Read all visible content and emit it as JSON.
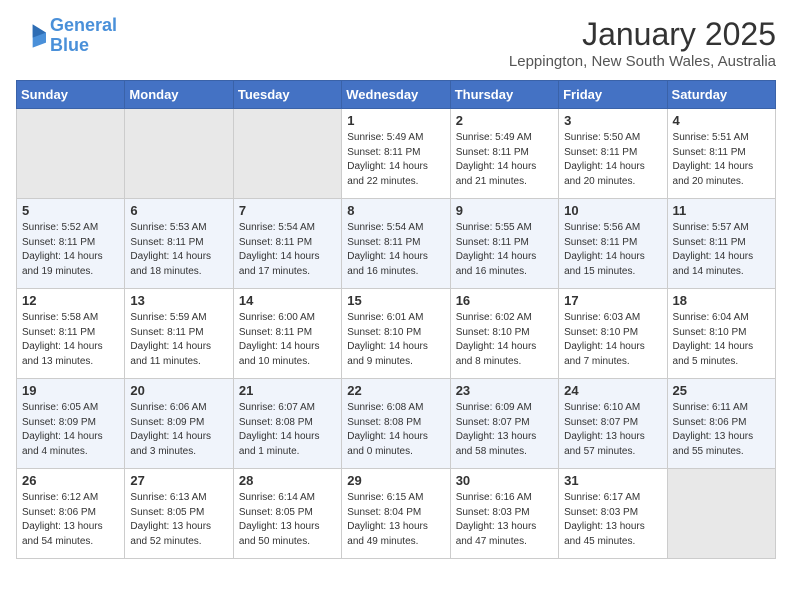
{
  "logo": {
    "line1": "General",
    "line2": "Blue"
  },
  "title": "January 2025",
  "location": "Leppington, New South Wales, Australia",
  "weekdays": [
    "Sunday",
    "Monday",
    "Tuesday",
    "Wednesday",
    "Thursday",
    "Friday",
    "Saturday"
  ],
  "weeks": [
    [
      {
        "day": "",
        "info": ""
      },
      {
        "day": "",
        "info": ""
      },
      {
        "day": "",
        "info": ""
      },
      {
        "day": "1",
        "info": "Sunrise: 5:49 AM\nSunset: 8:11 PM\nDaylight: 14 hours\nand 22 minutes."
      },
      {
        "day": "2",
        "info": "Sunrise: 5:49 AM\nSunset: 8:11 PM\nDaylight: 14 hours\nand 21 minutes."
      },
      {
        "day": "3",
        "info": "Sunrise: 5:50 AM\nSunset: 8:11 PM\nDaylight: 14 hours\nand 20 minutes."
      },
      {
        "day": "4",
        "info": "Sunrise: 5:51 AM\nSunset: 8:11 PM\nDaylight: 14 hours\nand 20 minutes."
      }
    ],
    [
      {
        "day": "5",
        "info": "Sunrise: 5:52 AM\nSunset: 8:11 PM\nDaylight: 14 hours\nand 19 minutes."
      },
      {
        "day": "6",
        "info": "Sunrise: 5:53 AM\nSunset: 8:11 PM\nDaylight: 14 hours\nand 18 minutes."
      },
      {
        "day": "7",
        "info": "Sunrise: 5:54 AM\nSunset: 8:11 PM\nDaylight: 14 hours\nand 17 minutes."
      },
      {
        "day": "8",
        "info": "Sunrise: 5:54 AM\nSunset: 8:11 PM\nDaylight: 14 hours\nand 16 minutes."
      },
      {
        "day": "9",
        "info": "Sunrise: 5:55 AM\nSunset: 8:11 PM\nDaylight: 14 hours\nand 16 minutes."
      },
      {
        "day": "10",
        "info": "Sunrise: 5:56 AM\nSunset: 8:11 PM\nDaylight: 14 hours\nand 15 minutes."
      },
      {
        "day": "11",
        "info": "Sunrise: 5:57 AM\nSunset: 8:11 PM\nDaylight: 14 hours\nand 14 minutes."
      }
    ],
    [
      {
        "day": "12",
        "info": "Sunrise: 5:58 AM\nSunset: 8:11 PM\nDaylight: 14 hours\nand 13 minutes."
      },
      {
        "day": "13",
        "info": "Sunrise: 5:59 AM\nSunset: 8:11 PM\nDaylight: 14 hours\nand 11 minutes."
      },
      {
        "day": "14",
        "info": "Sunrise: 6:00 AM\nSunset: 8:11 PM\nDaylight: 14 hours\nand 10 minutes."
      },
      {
        "day": "15",
        "info": "Sunrise: 6:01 AM\nSunset: 8:10 PM\nDaylight: 14 hours\nand 9 minutes."
      },
      {
        "day": "16",
        "info": "Sunrise: 6:02 AM\nSunset: 8:10 PM\nDaylight: 14 hours\nand 8 minutes."
      },
      {
        "day": "17",
        "info": "Sunrise: 6:03 AM\nSunset: 8:10 PM\nDaylight: 14 hours\nand 7 minutes."
      },
      {
        "day": "18",
        "info": "Sunrise: 6:04 AM\nSunset: 8:10 PM\nDaylight: 14 hours\nand 5 minutes."
      }
    ],
    [
      {
        "day": "19",
        "info": "Sunrise: 6:05 AM\nSunset: 8:09 PM\nDaylight: 14 hours\nand 4 minutes."
      },
      {
        "day": "20",
        "info": "Sunrise: 6:06 AM\nSunset: 8:09 PM\nDaylight: 14 hours\nand 3 minutes."
      },
      {
        "day": "21",
        "info": "Sunrise: 6:07 AM\nSunset: 8:08 PM\nDaylight: 14 hours\nand 1 minute."
      },
      {
        "day": "22",
        "info": "Sunrise: 6:08 AM\nSunset: 8:08 PM\nDaylight: 14 hours\nand 0 minutes."
      },
      {
        "day": "23",
        "info": "Sunrise: 6:09 AM\nSunset: 8:07 PM\nDaylight: 13 hours\nand 58 minutes."
      },
      {
        "day": "24",
        "info": "Sunrise: 6:10 AM\nSunset: 8:07 PM\nDaylight: 13 hours\nand 57 minutes."
      },
      {
        "day": "25",
        "info": "Sunrise: 6:11 AM\nSunset: 8:06 PM\nDaylight: 13 hours\nand 55 minutes."
      }
    ],
    [
      {
        "day": "26",
        "info": "Sunrise: 6:12 AM\nSunset: 8:06 PM\nDaylight: 13 hours\nand 54 minutes."
      },
      {
        "day": "27",
        "info": "Sunrise: 6:13 AM\nSunset: 8:05 PM\nDaylight: 13 hours\nand 52 minutes."
      },
      {
        "day": "28",
        "info": "Sunrise: 6:14 AM\nSunset: 8:05 PM\nDaylight: 13 hours\nand 50 minutes."
      },
      {
        "day": "29",
        "info": "Sunrise: 6:15 AM\nSunset: 8:04 PM\nDaylight: 13 hours\nand 49 minutes."
      },
      {
        "day": "30",
        "info": "Sunrise: 6:16 AM\nSunset: 8:03 PM\nDaylight: 13 hours\nand 47 minutes."
      },
      {
        "day": "31",
        "info": "Sunrise: 6:17 AM\nSunset: 8:03 PM\nDaylight: 13 hours\nand 45 minutes."
      },
      {
        "day": "",
        "info": ""
      }
    ]
  ]
}
